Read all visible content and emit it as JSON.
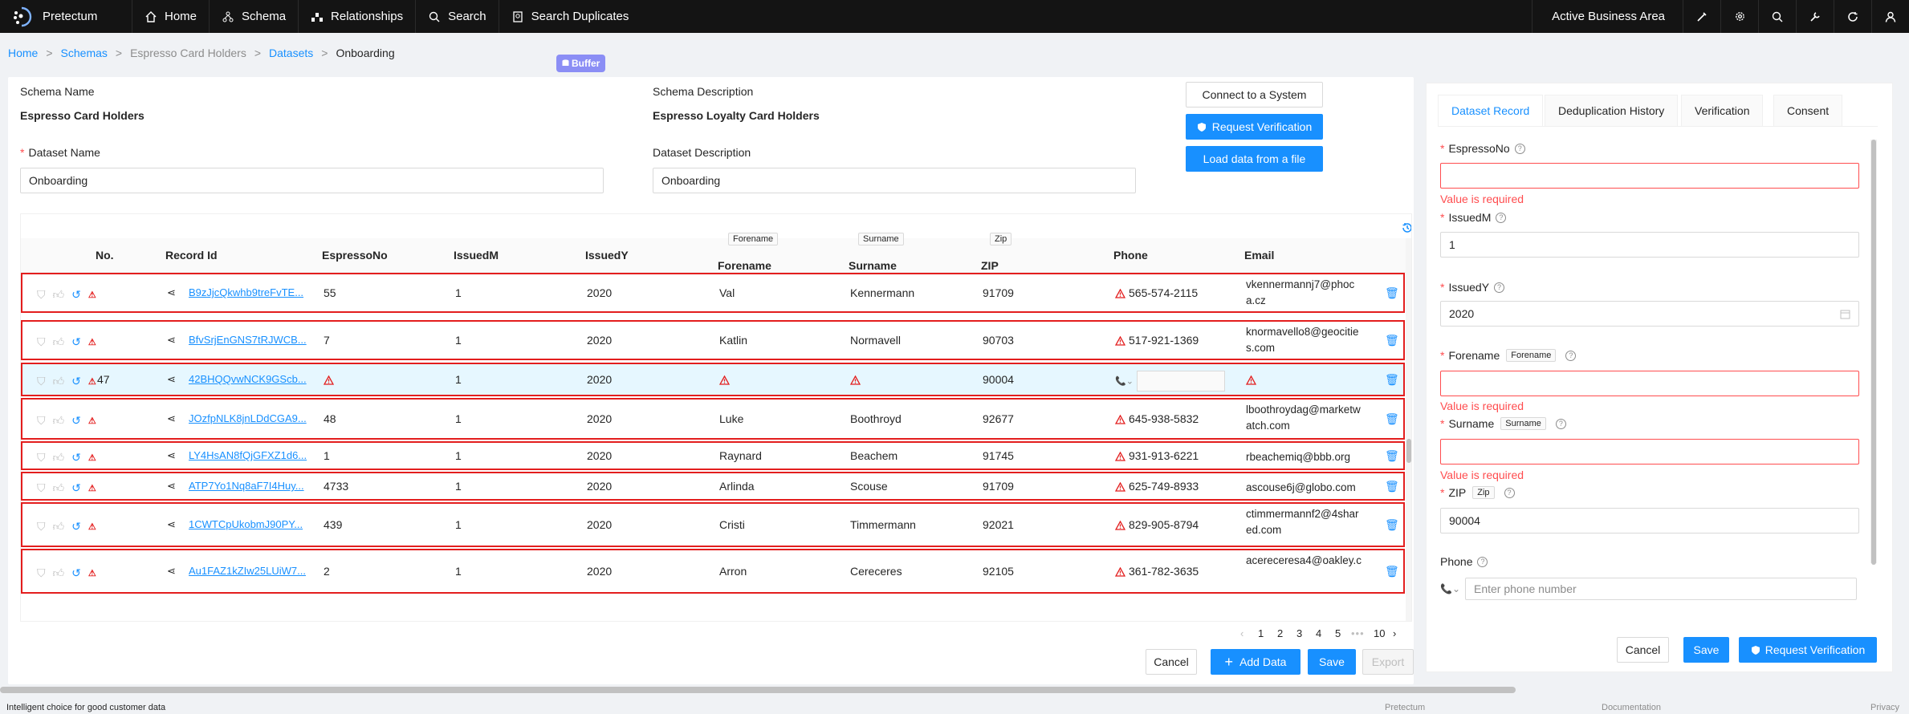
{
  "nav": {
    "brand": "Pretectum",
    "items": [
      "Home",
      "Schema",
      "Relationships",
      "Search",
      "Search Duplicates"
    ],
    "area": "Active Business Area"
  },
  "crumbs": {
    "home": "Home",
    "schemas": "Schemas",
    "holder": "Espresso Card Holders",
    "datasets": "Datasets",
    "current": "Onboarding"
  },
  "buffer": "Buffer",
  "form": {
    "schema_name_label": "Schema Name",
    "schema_name": "Espresso Card Holders",
    "schema_desc_label": "Schema Description",
    "schema_desc": "Espresso Loyalty Card Holders",
    "dataset_name_label": "Dataset Name",
    "dataset_name": "Onboarding",
    "dataset_desc_label": "Dataset Description",
    "dataset_desc": "Onboarding",
    "connect": "Connect to a System",
    "request": "Request Verification",
    "load": "Load data from a file"
  },
  "table": {
    "headers": {
      "no": "No.",
      "record": "Record Id",
      "espresso": "EspressoNo",
      "issuedm": "IssuedM",
      "issuedy": "IssuedY",
      "forename": "Forename",
      "forename_tag": "Forename",
      "surname": "Surname",
      "surname_tag": "Surname",
      "zip": "ZIP",
      "zip_tag": "Zip",
      "phone": "Phone",
      "email": "Email"
    },
    "rows": [
      {
        "no": "",
        "record": "B9zJjcQkwhb9treFvTE...",
        "esp": "55",
        "m": "1",
        "y": "2020",
        "fn": "Val",
        "sn": "Kennermann",
        "zip": "91709",
        "phone": "565-574-2115",
        "email": "vkennermannj7@phoca.cz"
      },
      {
        "no": "",
        "record": "BfvSrjEnGNS7tRJWCB...",
        "esp": "7",
        "m": "1",
        "y": "2020",
        "fn": "Katlin",
        "sn": "Normavell",
        "zip": "90703",
        "phone": "517-921-1369",
        "email": "knormavello8@geocities.com"
      },
      {
        "no": "47",
        "record": "42BHQQvwNCK9GScb...",
        "esp": "",
        "m": "1",
        "y": "2020",
        "fn": "",
        "sn": "",
        "zip": "90004",
        "phone": "",
        "email": ""
      },
      {
        "no": "",
        "record": "JOzfpNLK8jnLDdCGA9...",
        "esp": "48",
        "m": "1",
        "y": "2020",
        "fn": "Luke",
        "sn": "Boothroyd",
        "zip": "92677",
        "phone": "645-938-5832",
        "email": "lboothroydag@marketwatch.com"
      },
      {
        "no": "",
        "record": "LY4HsAN8fQjGFXZ1d6...",
        "esp": "1",
        "m": "1",
        "y": "2020",
        "fn": "Raynard",
        "sn": "Beachem",
        "zip": "91745",
        "phone": "931-913-6221",
        "email": "rbeachemiq@bbb.org"
      },
      {
        "no": "",
        "record": "ATP7Yo1Nq8aF7I4Huy...",
        "esp": "4733",
        "m": "1",
        "y": "2020",
        "fn": "Arlinda",
        "sn": "Scouse",
        "zip": "91709",
        "phone": "625-749-8933",
        "email": "ascouse6j@globo.com"
      },
      {
        "no": "",
        "record": "1CWTCpUkobmJ90PY...",
        "esp": "439",
        "m": "1",
        "y": "2020",
        "fn": "Cristi",
        "sn": "Timmermann",
        "zip": "92021",
        "phone": "829-905-8794",
        "email": "ctimmermannf2@4shared.com"
      },
      {
        "no": "",
        "record": "Au1FAZ1kZIw25LUiW7...",
        "esp": "2",
        "m": "1",
        "y": "2020",
        "fn": "Arron",
        "sn": "Cereceres",
        "zip": "92105",
        "phone": "361-782-3635",
        "email": "acereceresa4@oakley.c"
      }
    ]
  },
  "pagination": {
    "pages": [
      "1",
      "2",
      "3",
      "4",
      "5"
    ],
    "dots": "•••",
    "last": "10"
  },
  "bottom": {
    "cancel": "Cancel",
    "add": "Add Data",
    "save": "Save",
    "export": "Export"
  },
  "panel": {
    "tabs": [
      "Dataset Record",
      "Deduplication History",
      "Verification",
      "Consent"
    ],
    "espresso_label": "EspressoNo",
    "err": "Value is required",
    "issuedm_label": "IssuedM",
    "issuedm": "1",
    "issuedy_label": "IssuedY",
    "issuedy": "2020",
    "forename_label": "Forename",
    "forename_tag": "Forename",
    "surname_label": "Surname",
    "surname_tag": "Surname",
    "zip_label": "ZIP",
    "zip_tag": "Zip",
    "zip": "90004",
    "phone_label": "Phone",
    "phone_placeholder": "Enter phone number",
    "cancel": "Cancel",
    "save": "Save",
    "request": "Request Verification"
  },
  "footer": {
    "tagline": "Intelligent choice for good customer data",
    "brand": "Pretectum",
    "docs": "Documentation",
    "privacy": "Privacy"
  }
}
